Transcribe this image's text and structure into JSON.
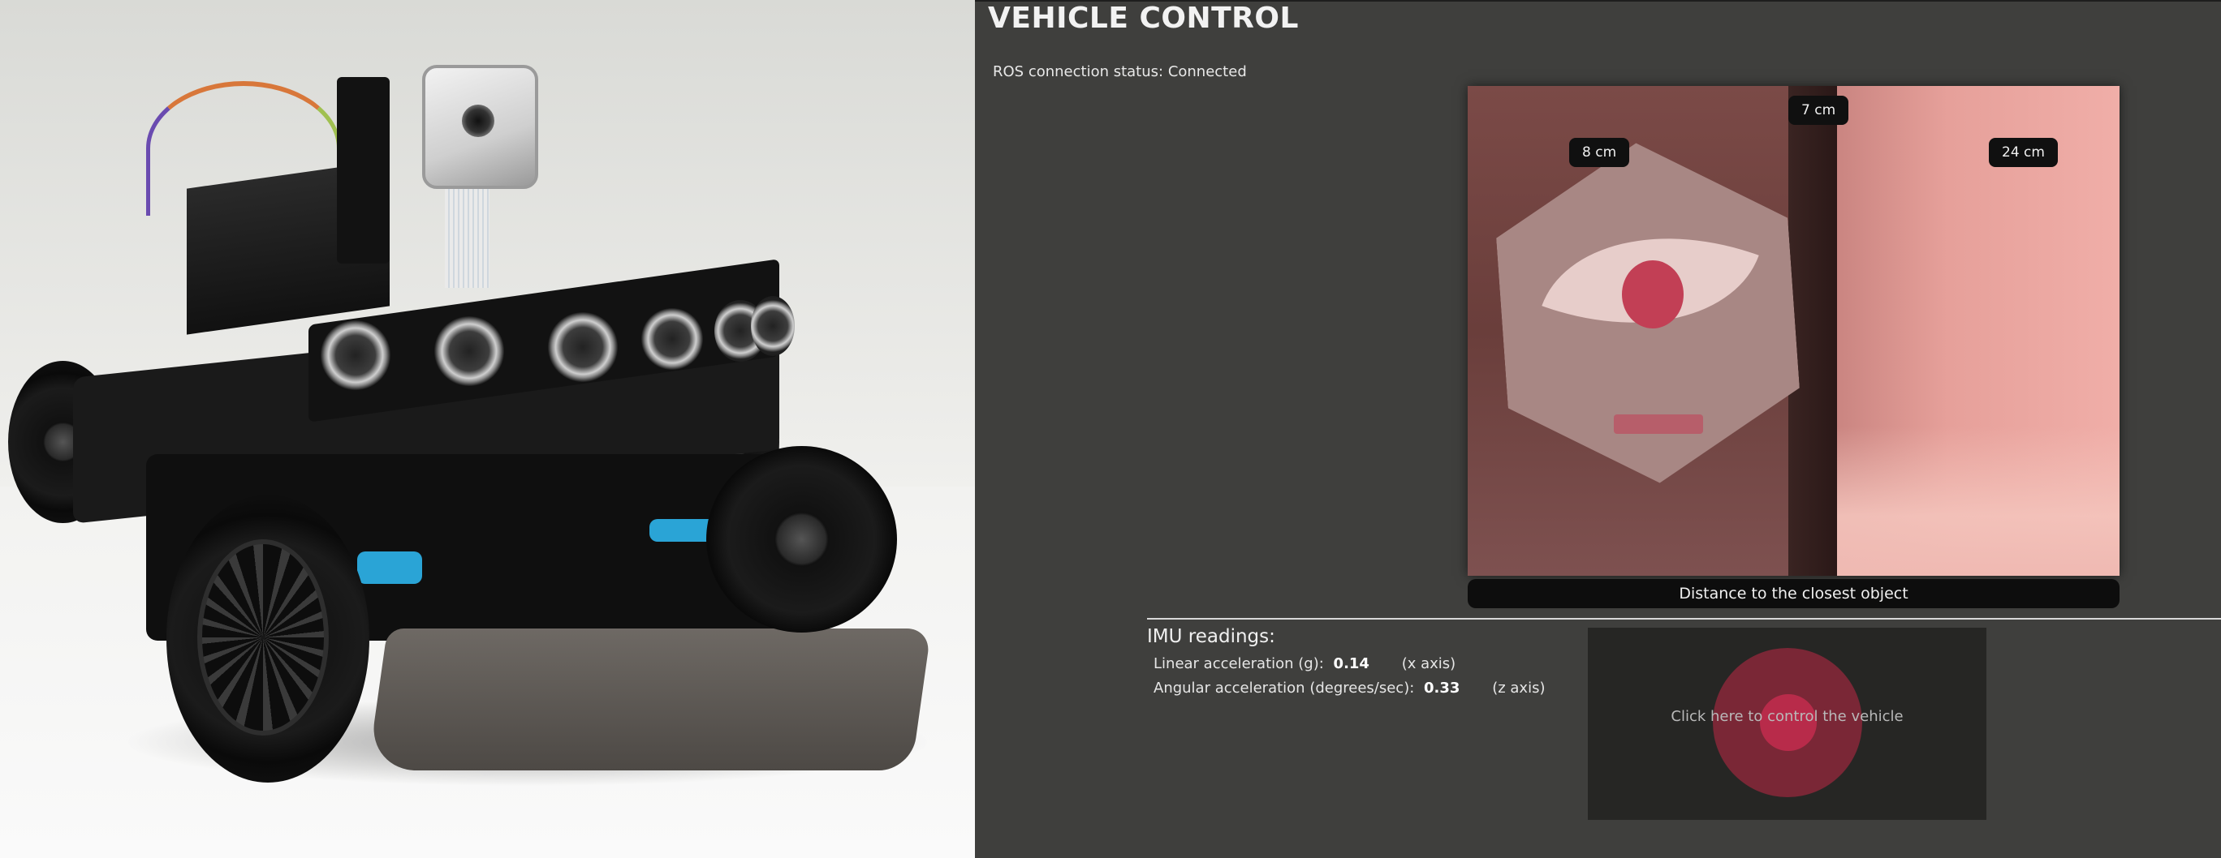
{
  "page": {
    "title": "VEHICLE CONTROL",
    "ros_status": "ROS connection status: Connected"
  },
  "camera": {
    "distance_labels": {
      "top": "7 cm",
      "left": "8 cm",
      "right": "24 cm"
    },
    "caption": "Distance to the closest object"
  },
  "imu": {
    "title": "IMU readings:",
    "linear": {
      "label": "Linear acceleration (g):",
      "value": "0.14",
      "axis": "(x axis)"
    },
    "angular": {
      "label": "Angular acceleration (degrees/sec):",
      "value": "0.33",
      "axis": "(z axis)"
    }
  },
  "control": {
    "hint": "Click here to control the vehicle"
  },
  "colors": {
    "background": "#3f3f3d",
    "control_pad": "#262624",
    "joystick": "#c02846",
    "label_bg": "#101010"
  },
  "icons": {
    "joystick": "joystick-circle"
  }
}
